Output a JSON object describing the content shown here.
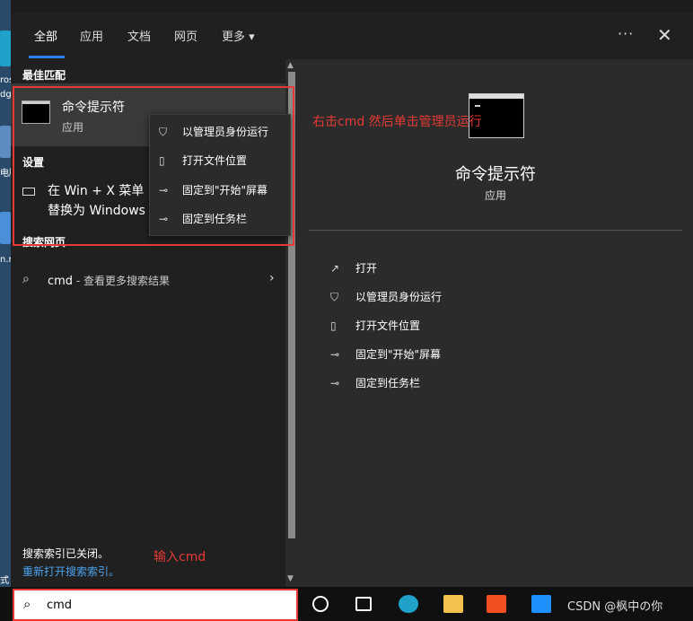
{
  "tabs": [
    "全部",
    "应用",
    "文档",
    "网页",
    "更多"
  ],
  "more_arrow": "▾",
  "top_actions": {
    "more": "···",
    "close": "✕"
  },
  "best_match": {
    "section": "最佳匹配",
    "title": "命令提示符",
    "subtitle": "应用"
  },
  "settings": {
    "section": "设置",
    "line1": "在 Win + X 菜单",
    "line2": "替换为 Windows"
  },
  "web": {
    "section": "搜索网页",
    "query": "cmd",
    "hint": " - 查看更多搜索结果"
  },
  "index_note": "搜索索引已关闭。",
  "index_link": "重新打开搜索索引。",
  "context_menu": [
    {
      "icon": "shield-icon",
      "glyph": "⛉",
      "label": "以管理员身份运行"
    },
    {
      "icon": "folder-icon",
      "glyph": "▯",
      "label": "打开文件位置"
    },
    {
      "icon": "pin-icon",
      "glyph": "⊸",
      "label": "固定到\"开始\"屏幕"
    },
    {
      "icon": "pin-icon",
      "glyph": "⊸",
      "label": "固定到任务栏"
    }
  ],
  "preview": {
    "title": "命令提示符",
    "subtitle": "应用",
    "actions": [
      {
        "icon": "open-icon",
        "glyph": "↗",
        "label": "打开"
      },
      {
        "icon": "shield-icon",
        "glyph": "⛉",
        "label": "以管理员身份运行"
      },
      {
        "icon": "folder-icon",
        "glyph": "▯",
        "label": "打开文件位置"
      },
      {
        "icon": "pin-icon",
        "glyph": "⊸",
        "label": "固定到\"开始\"屏幕"
      },
      {
        "icon": "pin-icon",
        "glyph": "⊸",
        "label": "固定到任务栏"
      }
    ]
  },
  "annotations": {
    "right_click": "右击cmd 然后单击管理员运行",
    "input": "输入cmd"
  },
  "annotation_color": "#e53935",
  "desktop_fragments": [
    "ros",
    "dg",
    "电脑",
    "n.r",
    "式"
  ],
  "search_box": {
    "value": "cmd",
    "icon": "search-icon"
  },
  "watermark": "CSDN @枫中の你",
  "colors": {
    "accent": "#2f80ed",
    "menu_bg": "#202020",
    "preview_bg": "#2b2b2b",
    "link": "#4aa3f0"
  }
}
